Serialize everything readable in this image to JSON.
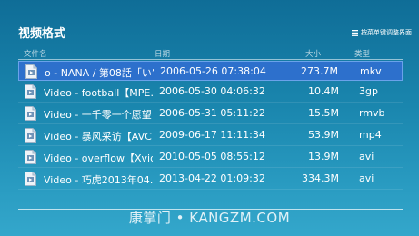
{
  "title": "视频格式",
  "menu_hint": "按菜单键调整界面",
  "columns": {
    "name": "文件名",
    "date": "日期",
    "size": "大小",
    "type": "类型"
  },
  "files": [
    {
      "name": "o - NANA / 第08話「い’",
      "date": "2006-05-26 07:38:04",
      "size": "273.7M",
      "type": "mkv",
      "selected": true
    },
    {
      "name": "Video - football【MPE…",
      "date": "2006-05-30 04:06:32",
      "size": "10.4M",
      "type": "3gp"
    },
    {
      "name": "Video - 一千零一个愿望…",
      "date": "2006-05-31 05:11:22",
      "size": "15.5M",
      "type": "rmvb"
    },
    {
      "name": "Video - 暴风采访【AVC…",
      "date": "2009-06-17 11:11:34",
      "size": "53.9M",
      "type": "mp4"
    },
    {
      "name": "Video - overflow【Xvid…",
      "date": "2010-05-05 08:55:12",
      "size": "13.9M",
      "type": "avi"
    },
    {
      "name": "Video - 巧虎2013年04…",
      "date": "2013-04-22 01:09:32",
      "size": "334.3M",
      "type": "avi"
    }
  ],
  "watermark": "康掌门 • KANGZM.COM"
}
